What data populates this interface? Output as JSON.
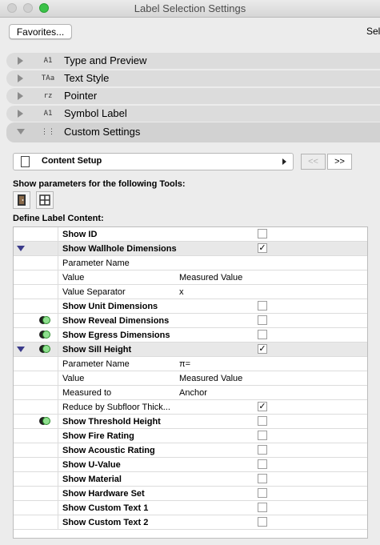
{
  "window": {
    "title": "Label Selection Settings"
  },
  "toolbar": {
    "favorites_label": "Favorites...",
    "right_text": "Sel"
  },
  "sections": [
    {
      "label": "Type and Preview",
      "icon": "A1"
    },
    {
      "label": "Text Style",
      "icon": "TAa"
    },
    {
      "label": "Pointer",
      "icon": "rz"
    },
    {
      "label": "Symbol Label",
      "icon": "A1"
    },
    {
      "label": "Custom Settings",
      "icon": "⋮⋮"
    }
  ],
  "content_setup": {
    "label": "Content Setup",
    "prev_label": "<<",
    "next_label": ">>"
  },
  "tools_heading": "Show parameters for the following Tools:",
  "define_heading": "Define Label Content:",
  "rows": [
    {
      "name": "Show ID",
      "bold": true,
      "checked": false,
      "group": false
    },
    {
      "name": "Show Wallhole Dimensions",
      "bold": true,
      "checked": true,
      "group": true,
      "triangle": true
    },
    {
      "name": "Parameter Name",
      "bold": false
    },
    {
      "name": "Value",
      "bold": false,
      "value": "Measured Value"
    },
    {
      "name": "Value Separator",
      "bold": false,
      "value": "x"
    },
    {
      "name": "Show Unit Dimensions",
      "bold": true,
      "checked": false
    },
    {
      "name": "Show Reveal Dimensions",
      "bold": true,
      "checked": false,
      "circle": true
    },
    {
      "name": "Show Egress Dimensions",
      "bold": true,
      "checked": false,
      "circle": true
    },
    {
      "name": "Show Sill Height",
      "bold": true,
      "checked": true,
      "group": true,
      "triangle": true,
      "circle": true
    },
    {
      "name": "Parameter Name",
      "bold": false,
      "value": "π="
    },
    {
      "name": "Value",
      "bold": false,
      "value": "Measured Value"
    },
    {
      "name": "Measured to",
      "bold": false,
      "value": "Anchor"
    },
    {
      "name": "Reduce by Subfloor Thick...",
      "bold": false,
      "checked": true
    },
    {
      "name": "Show Threshold Height",
      "bold": true,
      "checked": false,
      "circle": true
    },
    {
      "name": "Show Fire Rating",
      "bold": true,
      "checked": false
    },
    {
      "name": "Show Acoustic Rating",
      "bold": true,
      "checked": false
    },
    {
      "name": "Show U-Value",
      "bold": true,
      "checked": false
    },
    {
      "name": "Show Material",
      "bold": true,
      "checked": false
    },
    {
      "name": "Show Hardware Set",
      "bold": true,
      "checked": false
    },
    {
      "name": "Show Custom Text 1",
      "bold": true,
      "checked": false
    },
    {
      "name": "Show Custom Text 2",
      "bold": true,
      "checked": false
    }
  ],
  "check_mark": "✓"
}
